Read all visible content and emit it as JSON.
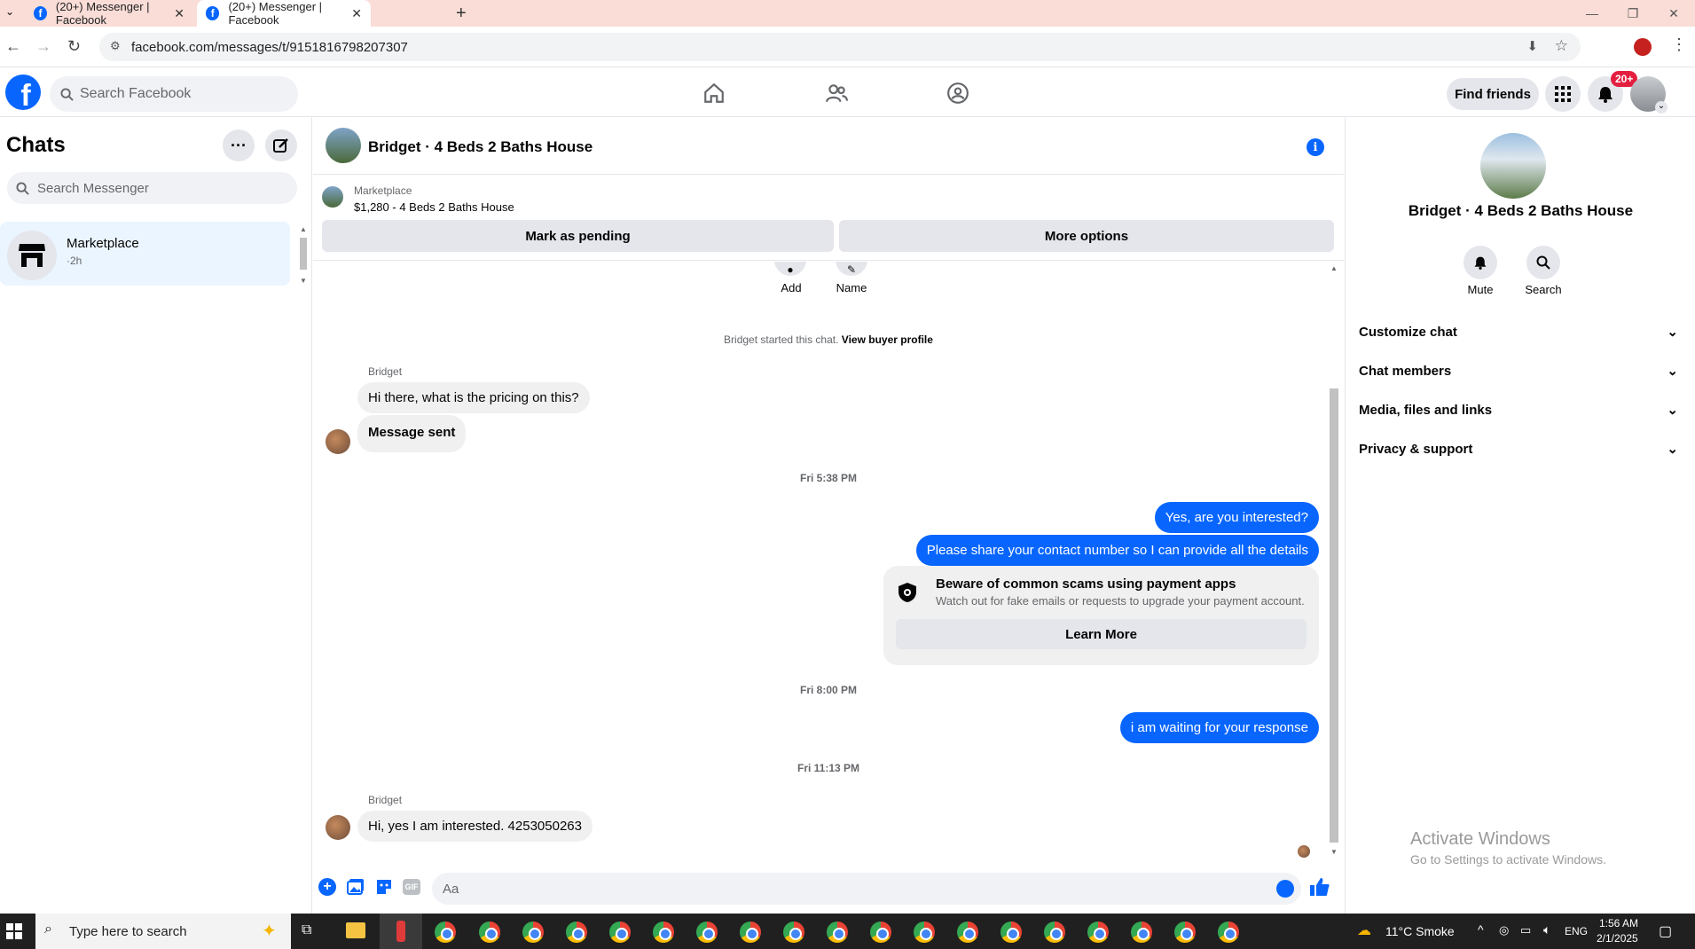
{
  "browser": {
    "tabs": [
      {
        "title": "(20+) Messenger | Facebook"
      },
      {
        "title": "(20+) Messenger | Facebook"
      }
    ],
    "url": "facebook.com/messages/t/9151816798207307"
  },
  "fb_header": {
    "logo": "f",
    "search_placeholder": "Search Facebook",
    "find_friends": "Find friends",
    "notif_badge": "20+"
  },
  "sidebar": {
    "title": "Chats",
    "search_placeholder": "Search Messenger",
    "chats": [
      {
        "name": "Marketplace",
        "time": "·2h"
      }
    ]
  },
  "conversation": {
    "title": "Bridget · 4 Beds 2 Baths House",
    "banner": {
      "label": "Marketplace",
      "listing": "$1,280 - 4 Beds 2 Baths House",
      "mark_pending": "Mark as pending",
      "more_options": "More options"
    },
    "quick_actions": {
      "add": "Add",
      "name": "Name"
    },
    "started_text": "Bridget started this chat.",
    "view_buyer": "View buyer profile",
    "messages": [
      {
        "sender": "Bridget",
        "text": "Hi there, what is the pricing on this?"
      },
      {
        "text": "Message sent"
      },
      {
        "timestamp": "Fri 5:38 PM"
      },
      {
        "text": "Yes, are you interested?"
      },
      {
        "text": "Please share your contact number so I can provide all the details"
      },
      {
        "timestamp": "Fri 8:00 PM"
      },
      {
        "text": "i am waiting for your response"
      },
      {
        "timestamp": "Fri 11:13 PM"
      },
      {
        "sender": "Bridget",
        "text": "Hi, yes I am interested. 4253050263"
      }
    ],
    "scam_card": {
      "title": "Beware of common scams using payment apps",
      "body": "Watch out for fake emails or requests to upgrade your payment account.",
      "button": "Learn More"
    },
    "composer_placeholder": "Aa"
  },
  "right_panel": {
    "title": "Bridget · 4 Beds 2 Baths House",
    "mute": "Mute",
    "search": "Search",
    "sections": [
      "Customize chat",
      "Chat members",
      "Media, files and links",
      "Privacy & support"
    ]
  },
  "watermark": {
    "title": "Activate Windows",
    "subtitle": "Go to Settings to activate Windows."
  },
  "taskbar": {
    "search_placeholder": "Type here to search",
    "weather": "11°C  Smoke",
    "lang": "ENG",
    "time": "1:56 AM",
    "date": "2/1/2025"
  },
  "colors": {
    "accent": "#0866ff",
    "bubble_in": "#f0f0f0",
    "tab_bar": "#f9ddd6",
    "badge": "#e41e3f"
  }
}
